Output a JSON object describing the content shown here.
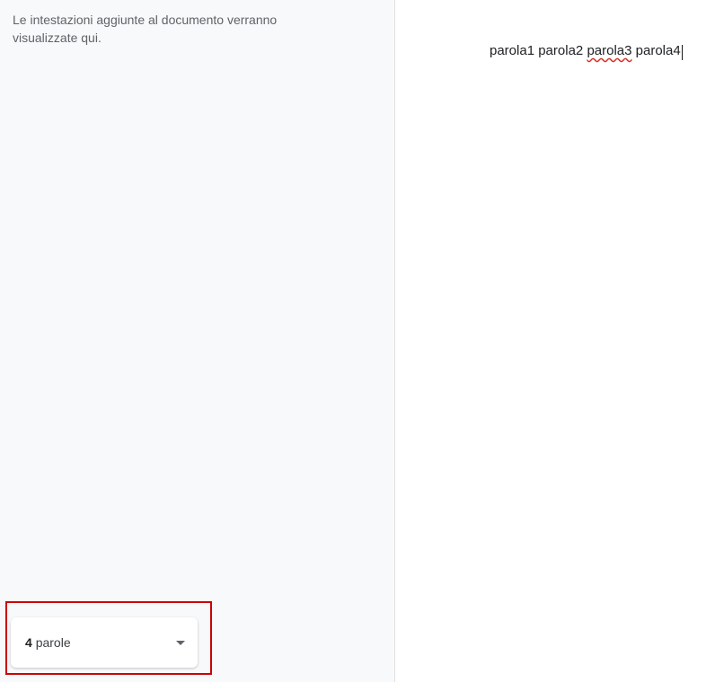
{
  "sidebar": {
    "outline_hint": "Le intestazioni aggiunte al documento verranno visualizzate qui."
  },
  "document": {
    "words": [
      {
        "text": "parola1",
        "spellError": false
      },
      {
        "text": "parola2",
        "spellError": false
      },
      {
        "text": "parola3",
        "spellError": true
      },
      {
        "text": "parola4",
        "spellError": false
      }
    ]
  },
  "wordcount": {
    "count": "4",
    "unit_label": "parole"
  }
}
